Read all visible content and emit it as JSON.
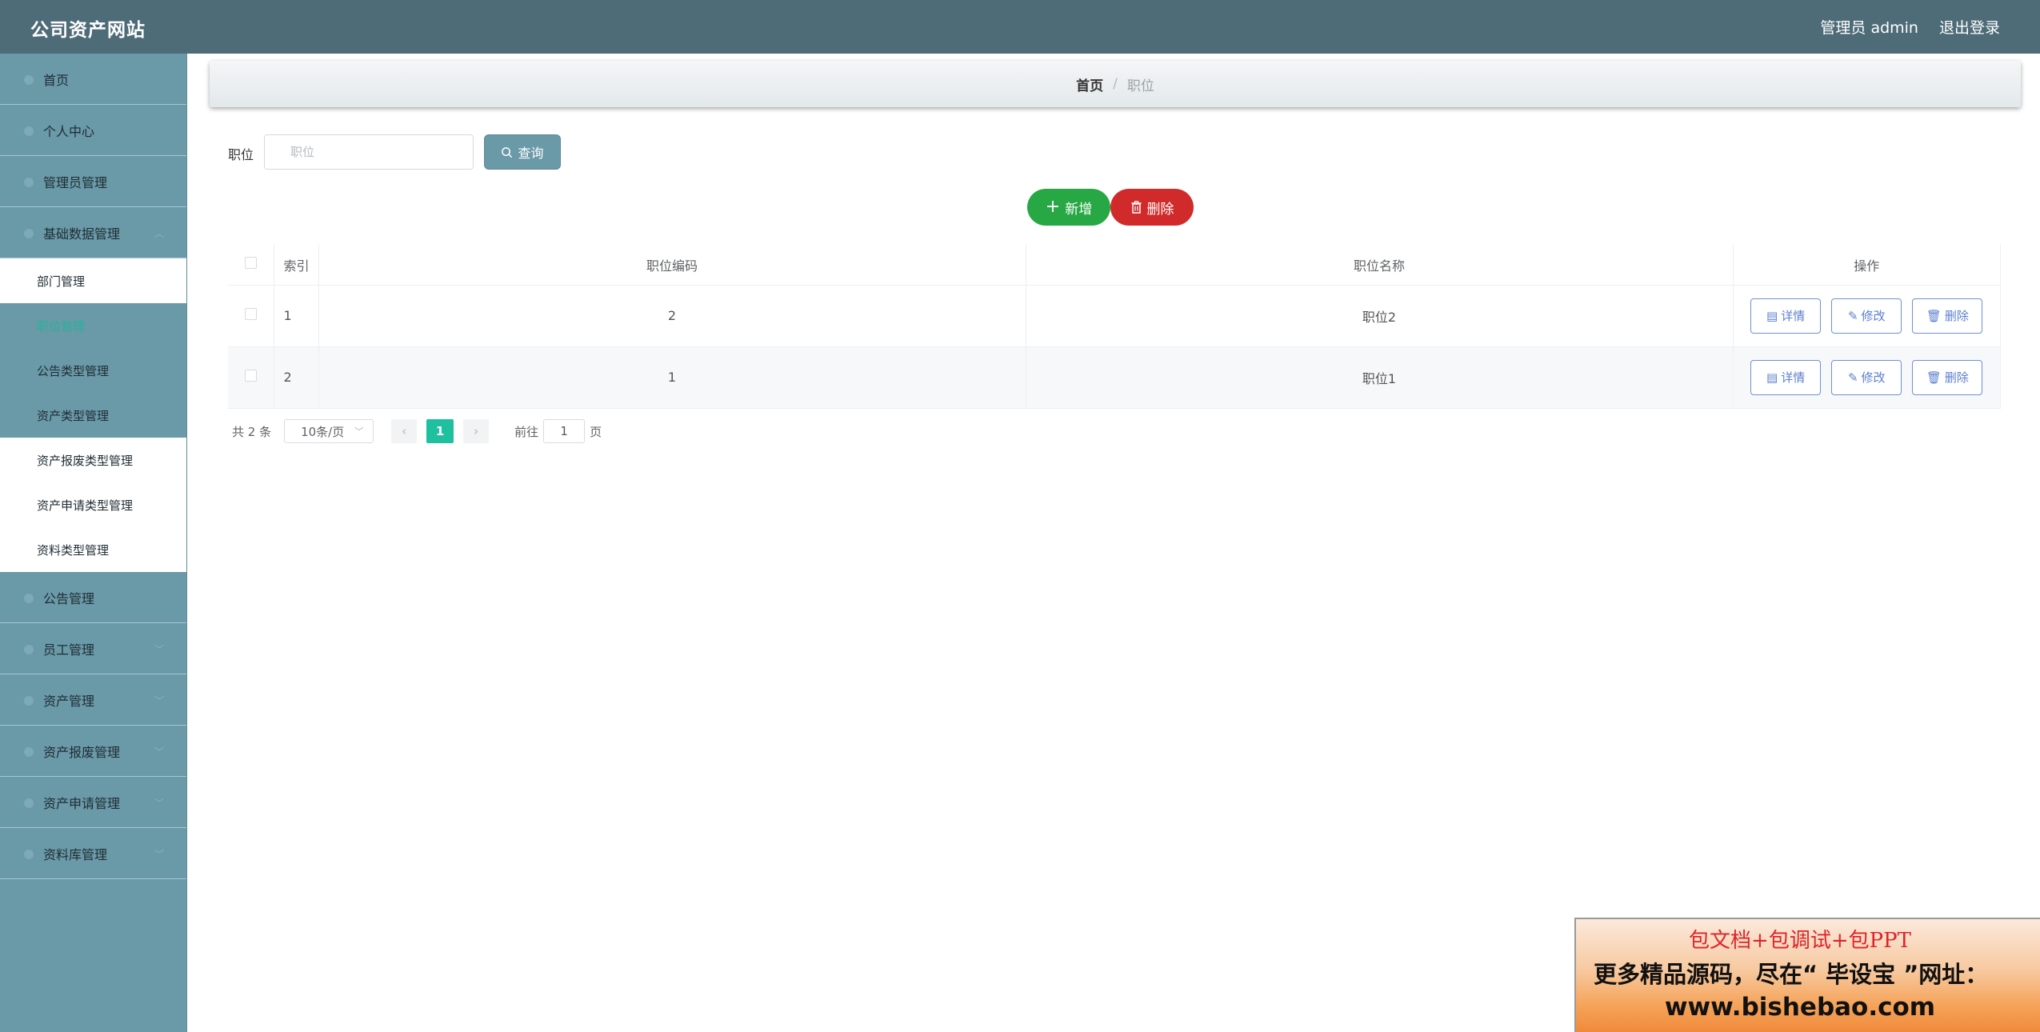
{
  "app": {
    "title": "公司资产网站",
    "user_label": "管理员 admin",
    "logout_label": "退出登录"
  },
  "sidebar": {
    "items": [
      {
        "label": "首页"
      },
      {
        "label": "个人中心"
      },
      {
        "label": "管理员管理"
      },
      {
        "label": "基础数据管理"
      }
    ],
    "submenu": [
      {
        "label": "部门管理"
      },
      {
        "label": "职位管理"
      },
      {
        "label": "公告类型管理"
      },
      {
        "label": "资产类型管理"
      },
      {
        "label": "资产报废类型管理"
      },
      {
        "label": "资产申请类型管理"
      },
      {
        "label": "资料类型管理"
      }
    ],
    "items_after": [
      {
        "label": "公告管理"
      },
      {
        "label": "员工管理"
      },
      {
        "label": "资产管理"
      },
      {
        "label": "资产报废管理"
      },
      {
        "label": "资产申请管理"
      },
      {
        "label": "资料库管理"
      }
    ]
  },
  "breadcrumb": {
    "home": "首页",
    "separator": "/",
    "current": "职位"
  },
  "search": {
    "label": "职位",
    "placeholder": "职位",
    "value": "",
    "button_label": "查询"
  },
  "actions": {
    "add_label": "新增",
    "delete_label": "删除"
  },
  "table": {
    "columns": [
      "索引",
      "职位编码",
      "职位名称",
      "操作"
    ],
    "rows": [
      {
        "index": "1",
        "code": "2",
        "name": "职位2"
      },
      {
        "index": "2",
        "code": "1",
        "name": "职位1"
      }
    ],
    "row_actions": {
      "detail": "详情",
      "edit": "修改",
      "delete": "删除"
    }
  },
  "pagination": {
    "total": "共 2 条",
    "page_size": "10条/页",
    "current_page": "1",
    "goto_prefix": "前往",
    "goto_value": "1",
    "goto_suffix": "页"
  },
  "ad": {
    "line1": "包文档+包调试+包PPT",
    "line2": "更多精品源码，尽在“ 毕设宝 ”网址：",
    "line3": "www.bishebao.com"
  },
  "colors": {
    "topbar": "#4e6b78",
    "sidebar": "#6a99a8",
    "add": "#27a844",
    "delete": "#d12a2a",
    "active_page": "#1fc0a0",
    "link_blue": "#5b7fd0"
  }
}
